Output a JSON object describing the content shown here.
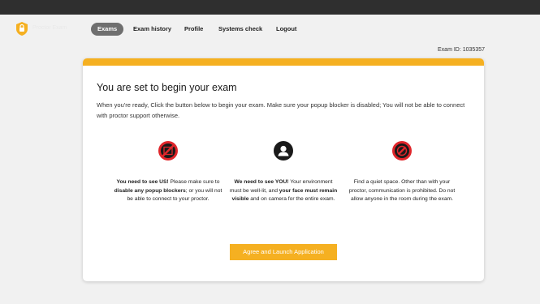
{
  "app": {
    "logo_text": "Proctor Exam"
  },
  "nav": {
    "items": [
      {
        "label": "Exams",
        "active": true
      },
      {
        "label": "Exam history"
      },
      {
        "label": "Profile"
      },
      {
        "label": "Systems check"
      },
      {
        "label": "Logout"
      }
    ]
  },
  "exam_id": "Exam ID: 1035357",
  "card": {
    "title": "You are set to begin your exam",
    "intro": "When you're ready, Click the button below to begin your exam. Make sure your popup blocker is disabled; You will not be able to connect with proctor support otherwise.",
    "columns": [
      {
        "icon": "no-popup-icon",
        "p1": "You need to see US!",
        "p2": " Please make sure to ",
        "p3": "disable any popup blockers",
        "p4": "; or you will not be able to connect to your proctor."
      },
      {
        "icon": "user-icon",
        "p1": "We need to see YOU!",
        "p2": " Your environment must be well-lit, and ",
        "p3": "your face must remain visible",
        "p4": " and on camera for the entire exam."
      },
      {
        "icon": "no-entry-icon",
        "text": "Find a quiet space. Other than with your proctor, communication is prohibited. Do not allow anyone in the room during the exam."
      }
    ],
    "button_label": "Agree and Launch Application"
  },
  "colors": {
    "accent": "#f5b021",
    "danger": "#e0262b",
    "topbar": "#2f2f2f"
  }
}
